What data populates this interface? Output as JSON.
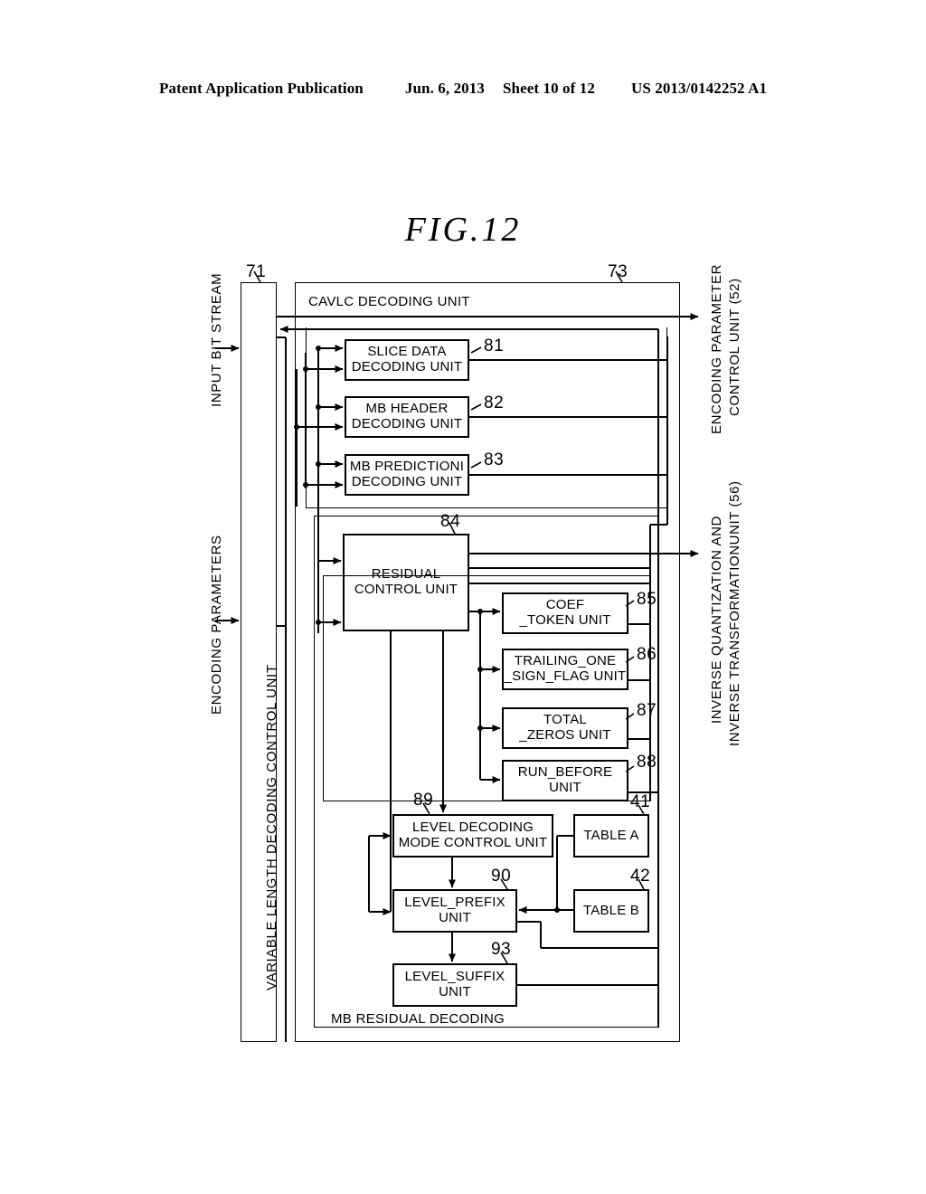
{
  "header": {
    "publication": "Patent Application Publication",
    "date": "Jun. 6, 2013",
    "sheet": "Sheet 10 of 12",
    "doc_number": "US 2013/0142252 A1"
  },
  "figure": {
    "title": "FIG.12"
  },
  "io_labels": {
    "input_bit_stream": "INPUT BIT STREAM",
    "encoding_parameters": "ENCODING PARAMETERS",
    "encoding_parameter_control_unit": "ENCODING PARAMETER\nCONTROL UNIT (52)",
    "encoding_parameter_control_unit_line1": "ENCODING PARAMETER",
    "encoding_parameter_control_unit_line2": "CONTROL UNIT (52)",
    "inverse_unit_line1": "INVERSE QUANTIZATION AND",
    "inverse_unit_line2": "INVERSE TRANSFORMATIONUNIT (56)"
  },
  "blocks": {
    "vldcu": {
      "label": "VARIABLE LENGTH DECODING CONTROL UNIT",
      "ref": "71"
    },
    "cavlc": {
      "label": "CAVLC DECODING UNIT",
      "ref": "73"
    },
    "slice_data": {
      "label": "SLICE DATA\nDECODING UNIT",
      "ref": "81"
    },
    "mb_header": {
      "label": "MB HEADER\nDECODING UNIT",
      "ref": "82"
    },
    "mb_prediction": {
      "label": "MB PREDICTIONI\nDECODING UNIT",
      "ref": "83"
    },
    "residual_control": {
      "label": "RESIDUAL\nCONTROL UNIT",
      "ref": "84"
    },
    "coef_token": {
      "label": "COEF\n_TOKEN UNIT",
      "ref": "85"
    },
    "trailing_one": {
      "label": "TRAILING_ONE\n_SIGN_FLAG UNIT",
      "ref": "86"
    },
    "total_zeros": {
      "label": "TOTAL\n_ZEROS UNIT",
      "ref": "87"
    },
    "run_before": {
      "label": "RUN_BEFORE\nUNIT",
      "ref": "88"
    },
    "level_mode": {
      "label": "LEVEL DECODING\nMODE CONTROL UNIT",
      "ref": "89"
    },
    "level_prefix": {
      "label": "LEVEL_PREFIX\nUNIT",
      "ref": "90"
    },
    "level_suffix": {
      "label": "LEVEL_SUFFIX\nUNIT",
      "ref": "93"
    },
    "table_a": {
      "label": "TABLE A",
      "ref": "41"
    },
    "table_b": {
      "label": "TABLE B",
      "ref": "42"
    },
    "mb_residual": {
      "label": "MB RESIDUAL DECODING"
    }
  },
  "colors": {
    "ink": "#000000",
    "paper": "#ffffff"
  }
}
